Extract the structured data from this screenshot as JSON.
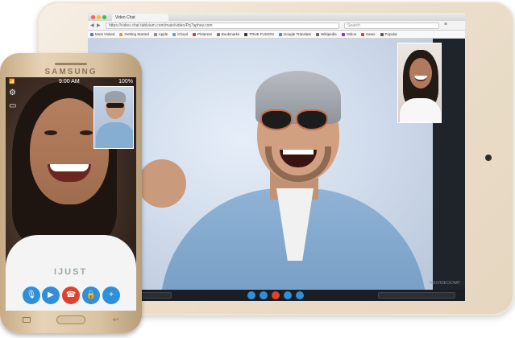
{
  "tablet": {
    "browser": {
      "tab_title": "Video Chat",
      "url": "https://video.chat.tablyium.com/main/video/Pq7aphey.com",
      "search_placeholder": "Search",
      "bookmarks": [
        "Most Visited",
        "Getting Started",
        "Apple",
        "iCloud",
        "Pinterest",
        "Bookmarks",
        "TRUE FUSION",
        "Google Translate",
        "Wikipedia",
        "Yahoo",
        "News",
        "Popular"
      ]
    },
    "watermark": "TRUVIDEOCHAT",
    "controls": [
      "mic",
      "video",
      "end-call",
      "lock",
      "add"
    ]
  },
  "phone": {
    "brand": "SAMSUNG",
    "status": {
      "time": "9:00 AM",
      "battery": "100%"
    },
    "shirt_text": "IJUST",
    "controls": [
      "mic",
      "video",
      "end-call",
      "lock",
      "add"
    ]
  },
  "colors": {
    "control_blue": "#2f8fd8",
    "end_call_red": "#e2402f"
  }
}
